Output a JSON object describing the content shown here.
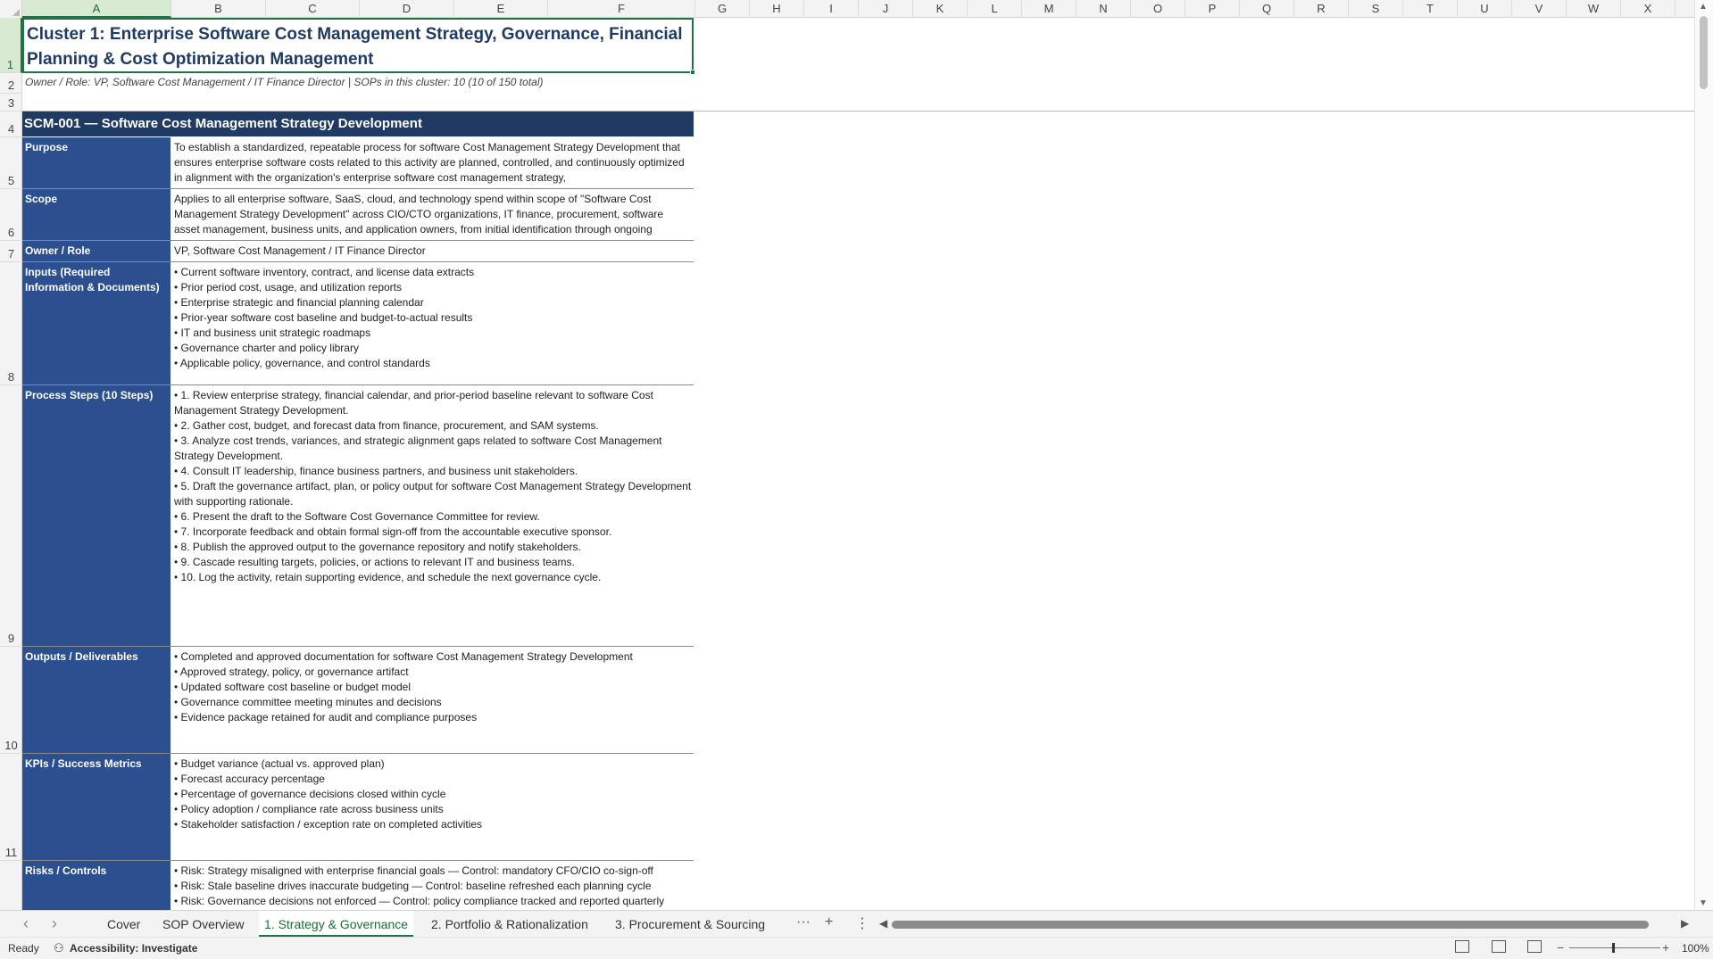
{
  "columns": [
    "A",
    "B",
    "C",
    "D",
    "E",
    "F",
    "G",
    "H",
    "I",
    "J",
    "K",
    "L",
    "M",
    "N",
    "O",
    "P",
    "Q",
    "R",
    "S",
    "T",
    "U",
    "V",
    "W",
    "X"
  ],
  "rows": [
    "1",
    "2",
    "3",
    "4",
    "5",
    "6",
    "7",
    "8",
    "9",
    "10",
    "11"
  ],
  "title": "Cluster 1: Enterprise Software Cost Management Strategy, Governance, Financial Planning & Cost Optimization Management",
  "subtitle": "Owner / Role: VP, Software Cost Management / IT Finance Director    |    SOPs in this cluster: 10 (10 of 150 total)",
  "sop": {
    "header": "SCM-001  —  Software Cost Management Strategy Development",
    "fields": [
      {
        "label": "Purpose",
        "lines": [
          "To establish a standardized, repeatable process for software Cost Management Strategy Development that ensures enterprise software costs related to this activity are planned, controlled, and continuously optimized in alignment with the organization's enterprise software cost management strategy,"
        ]
      },
      {
        "label": "Scope",
        "lines": [
          "Applies to all enterprise software, SaaS, cloud, and technology spend within scope of \"Software Cost Management Strategy Development\" across CIO/CTO organizations, IT finance, procurement, software asset management, business units, and application owners, from initial identification through ongoing"
        ]
      },
      {
        "label": "Owner / Role",
        "lines": [
          "VP, Software Cost Management / IT Finance Director"
        ]
      },
      {
        "label": "Inputs (Required Information & Documents)",
        "lines": [
          "• Current software inventory, contract, and license data extracts",
          "• Prior period cost, usage, and utilization reports",
          "• Enterprise strategic and financial planning calendar",
          "• Prior-year software cost baseline and budget-to-actual results",
          "• IT and business unit strategic roadmaps",
          "• Governance charter and policy library",
          "• Applicable policy, governance, and control standards"
        ]
      },
      {
        "label": "Process Steps (10 Steps)",
        "lines": [
          "• 1. Review enterprise strategy, financial calendar, and prior-period baseline relevant to software Cost Management Strategy Development.",
          "• 2. Gather cost, budget, and forecast data from finance, procurement, and SAM systems.",
          "• 3. Analyze cost trends, variances, and strategic alignment gaps related to software Cost Management Strategy Development.",
          "• 4. Consult IT leadership, finance business partners, and business unit stakeholders.",
          "• 5. Draft the governance artifact, plan, or policy output for software Cost Management Strategy Development with supporting rationale.",
          "• 6. Present the draft to the Software Cost Governance Committee for review.",
          "• 7. Incorporate feedback and obtain formal sign-off from the accountable executive sponsor.",
          "• 8. Publish the approved output to the governance repository and notify stakeholders.",
          "• 9. Cascade resulting targets, policies, or actions to relevant IT and business teams.",
          "• 10. Log the activity, retain supporting evidence, and schedule the next governance cycle."
        ]
      },
      {
        "label": "Outputs / Deliverables",
        "lines": [
          "• Completed and approved documentation for software Cost Management Strategy Development",
          "• Approved strategy, policy, or governance artifact",
          "• Updated software cost baseline or budget model",
          "• Governance committee meeting minutes and decisions",
          "• Evidence package retained for audit and compliance purposes"
        ]
      },
      {
        "label": "KPIs / Success Metrics",
        "lines": [
          "• Budget variance (actual vs. approved plan)",
          "• Forecast accuracy percentage",
          "• Percentage of governance decisions closed within cycle",
          "• Policy adoption / compliance rate across business units",
          "• Stakeholder satisfaction / exception rate on completed activities"
        ]
      },
      {
        "label": "Risks / Controls",
        "lines": [
          "• Risk: Strategy misaligned with enterprise financial goals — Control: mandatory CFO/CIO co-sign-off",
          "• Risk: Stale baseline drives inaccurate budgeting — Control: baseline refreshed each planning cycle",
          "• Risk: Governance decisions not enforced — Control: policy compliance tracked and reported quarterly"
        ]
      }
    ]
  },
  "tabs": [
    "Cover",
    "SOP Overview",
    "1. Strategy & Governance",
    "2. Portfolio & Rationalization",
    "3. Procurement & Sourcing"
  ],
  "active_tab": "1. Strategy & Governance",
  "tab_more": "···",
  "tab_add": "+",
  "tab_menu": "⋮",
  "status": {
    "ready": "Ready",
    "accessibility": "Accessibility: Investigate",
    "zoom": "100%"
  }
}
